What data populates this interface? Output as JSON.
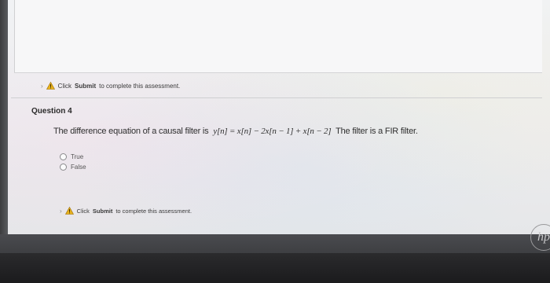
{
  "notice_top": {
    "prefix": "Click",
    "submit": "Submit",
    "suffix": "to complete this assessment."
  },
  "question": {
    "title": "Question 4",
    "text_before": "The difference equation of a causal filter is",
    "equation": "y[n] = x[n] − 2x[n − 1] + x[n − 2]",
    "text_after": "The filter is a FIR filter.",
    "options": [
      "True",
      "False"
    ]
  },
  "notice_bottom": {
    "prefix": "Click",
    "submit": "Submit",
    "suffix": "to complete this assessment."
  },
  "icons": {
    "warning": "warning-triangle-icon",
    "logo": "hp-logo"
  },
  "logo_text": "hp",
  "colors": {
    "warning_yellow": "#e8b21c",
    "page_bg": "#f1f2f4",
    "bezel": "#3f4044"
  }
}
